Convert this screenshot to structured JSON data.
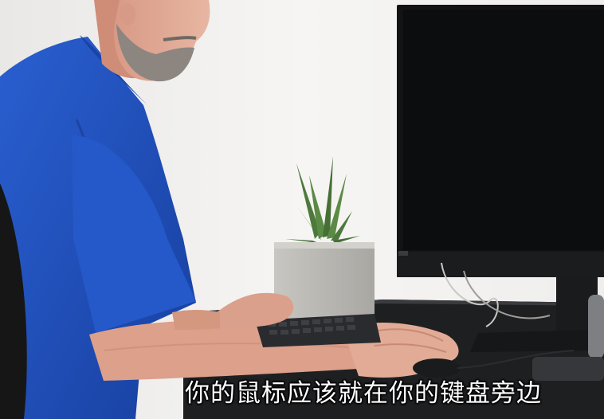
{
  "subtitle": "你的鼠标应该就在你的键盘旁边",
  "colors": {
    "wall": "#f2f1ef",
    "shirt": "#1f4fbf",
    "desk": "#1d1e20",
    "monitor": "#141516",
    "planter": "#bdbbb6",
    "plant": "#4d7a3c"
  }
}
